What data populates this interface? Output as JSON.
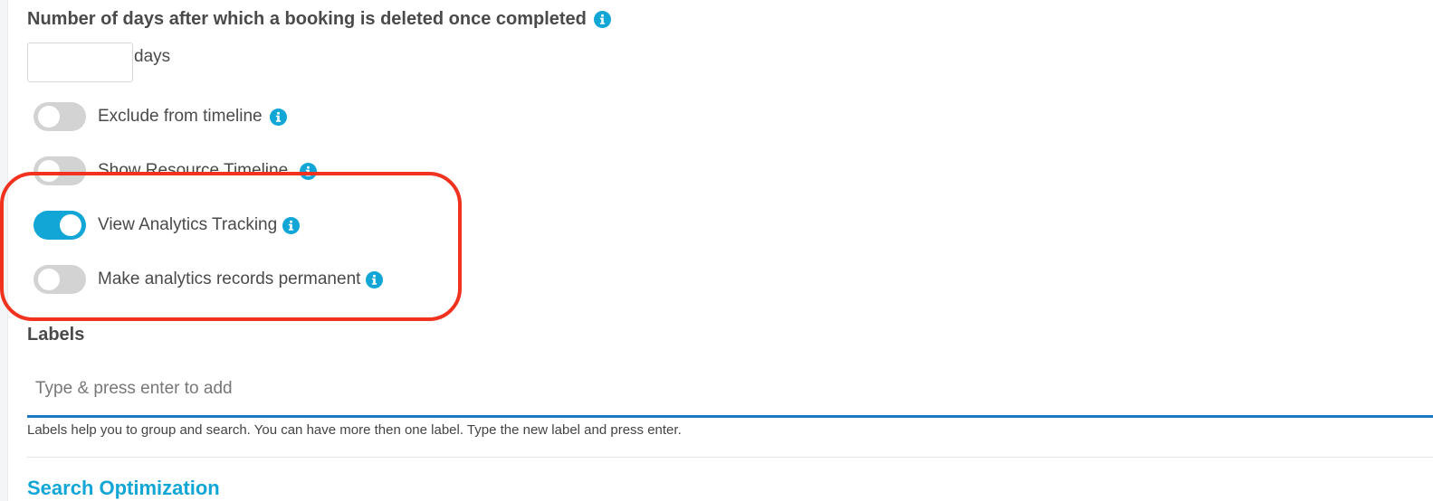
{
  "deletion": {
    "title": "Number of days after which a booking is deleted once completed",
    "days_value": "",
    "days_suffix": "days"
  },
  "toggles": [
    {
      "label": "Exclude from timeline",
      "on": false
    },
    {
      "label": "Show Resource Timeline",
      "on": false
    },
    {
      "label": "View Analytics Tracking",
      "on": true
    },
    {
      "label": "Make analytics records permanent",
      "on": false
    }
  ],
  "labels": {
    "title": "Labels",
    "placeholder": "Type & press enter to add",
    "help": "Labels help you to group and search. You can have more then one label. Type the new label and press enter."
  },
  "search_optimization": {
    "title": "Search Optimization"
  },
  "colors": {
    "accent": "#11a6d6",
    "highlight": "#f0321e",
    "toggle_off": "#d3d3d3",
    "input_underline": "#1a78c6"
  },
  "icons": [
    "info-icon"
  ]
}
